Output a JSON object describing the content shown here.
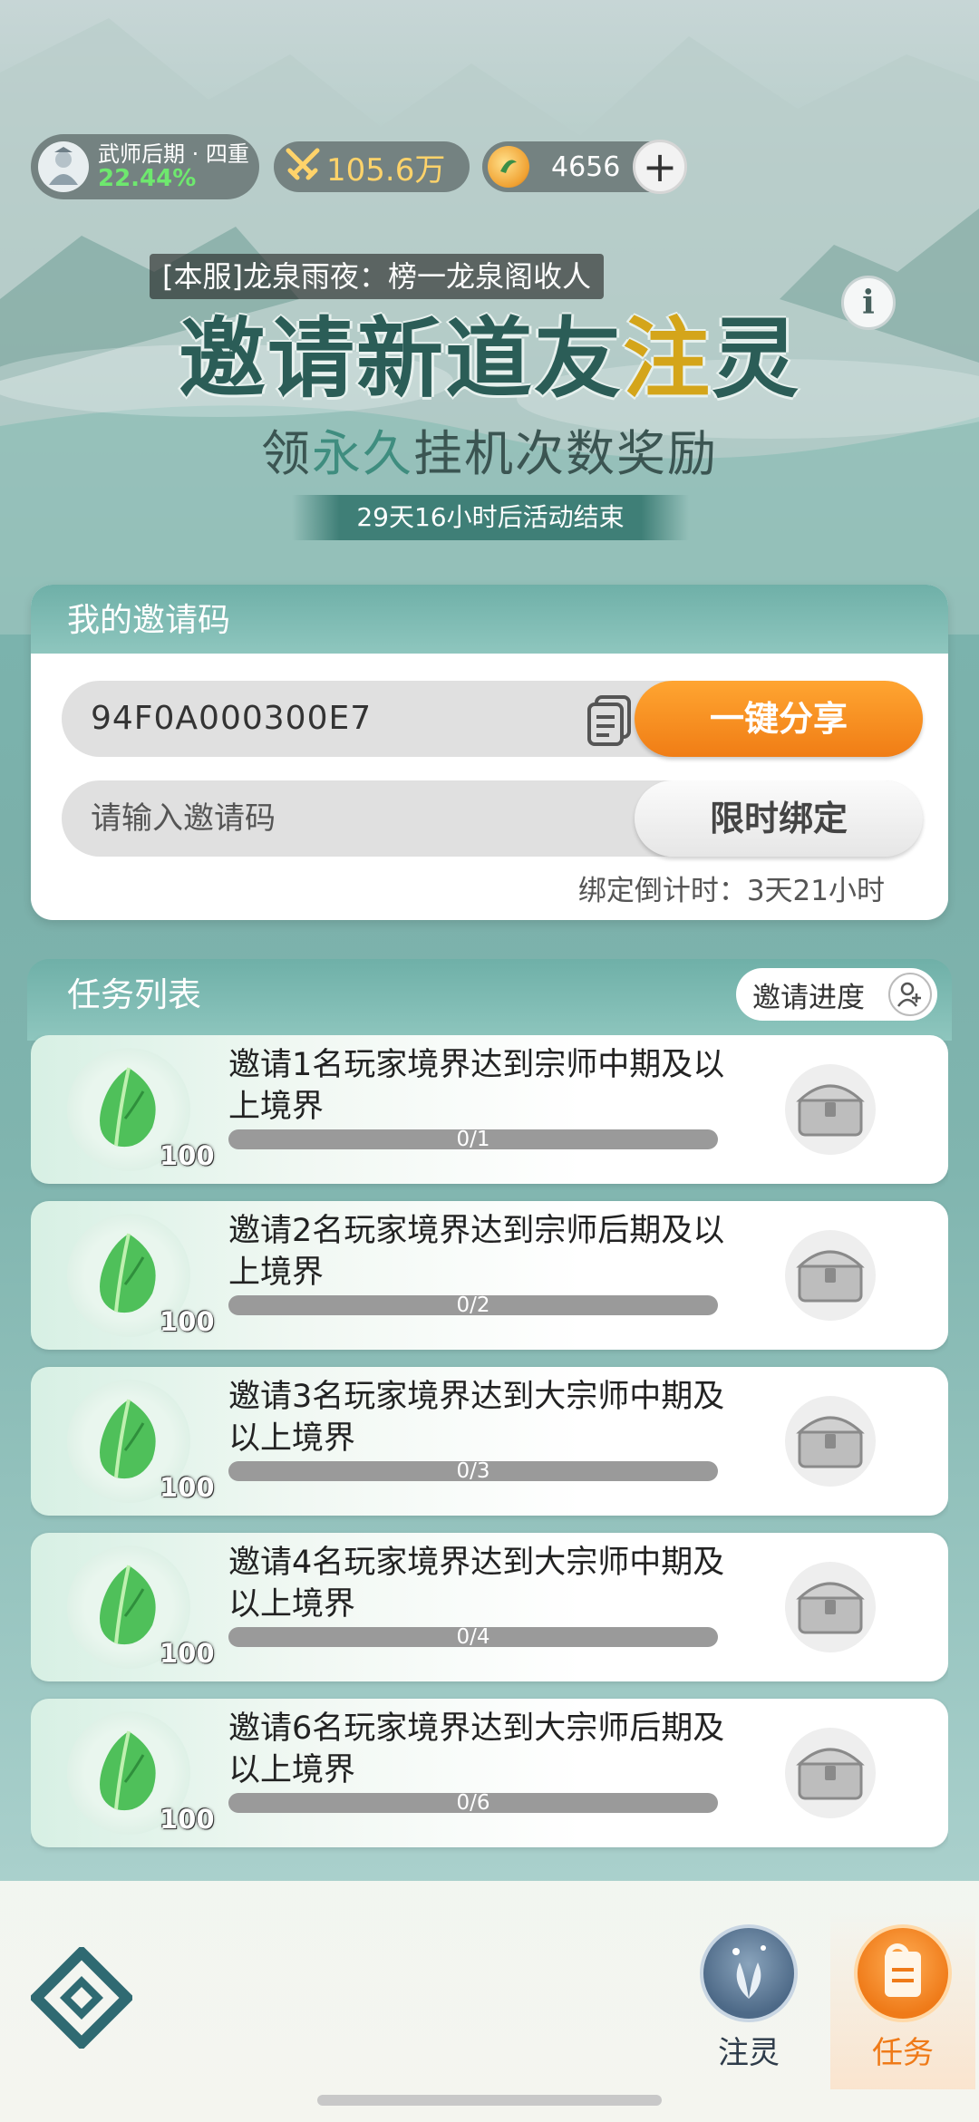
{
  "topbar": {
    "realm_name": "武师后期 · 四重",
    "realm_percent": "22.44%",
    "power": "105.6万",
    "coins": "4656",
    "add_label": "+"
  },
  "banner": {
    "ticker": "[本服]龙泉雨夜：榜一龙泉阁收人",
    "title_part1": "邀请新道友",
    "title_part2": "注",
    "title_part3": "灵",
    "info_label": "i",
    "subtitle_part1": "领",
    "subtitle_part2": "永久",
    "subtitle_part3": "挂机次数奖励",
    "countdown": "29天16小时后活动结束"
  },
  "invite": {
    "header": "我的邀请码",
    "my_code": "94F0A000300E7",
    "share_label": "一键分享",
    "input_placeholder": "请输入邀请码",
    "bind_label": "限时绑定",
    "bind_timer": "绑定倒计时：3天21小时"
  },
  "tasks": {
    "header": "任务列表",
    "progress_label": "邀请进度",
    "items": [
      {
        "desc": "邀请1名玩家境界达到宗师中期及以上境界",
        "progress": "0/1",
        "reward_count": "100"
      },
      {
        "desc": "邀请2名玩家境界达到宗师后期及以上境界",
        "progress": "0/2",
        "reward_count": "100"
      },
      {
        "desc": "邀请3名玩家境界达到大宗师中期及以上境界",
        "progress": "0/3",
        "reward_count": "100"
      },
      {
        "desc": "邀请4名玩家境界达到大宗师中期及以上境界",
        "progress": "0/4",
        "reward_count": "100"
      },
      {
        "desc": "邀请6名玩家境界达到大宗师后期及以上境界",
        "progress": "0/6",
        "reward_count": "100"
      }
    ]
  },
  "nav": {
    "tab_zhuling": "注灵",
    "tab_task": "任务"
  },
  "colors": {
    "accent": "#f07d15",
    "header_teal": "#6fb0a8",
    "realm_green": "#6ee86e"
  }
}
